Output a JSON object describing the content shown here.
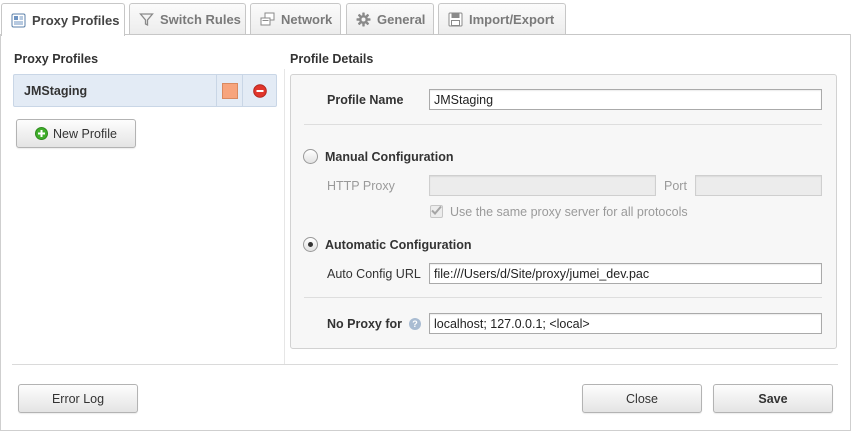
{
  "tabs": [
    {
      "label": "Proxy Profiles",
      "icon": "proxy-profiles-icon",
      "active": true
    },
    {
      "label": "Switch Rules",
      "icon": "switch-rules-icon",
      "active": false
    },
    {
      "label": "Network",
      "icon": "network-icon",
      "active": false
    },
    {
      "label": "General",
      "icon": "gear-icon",
      "active": false
    },
    {
      "label": "Import/Export",
      "icon": "disk-icon",
      "active": false
    }
  ],
  "left": {
    "title": "Proxy Profiles",
    "profiles": [
      {
        "name": "JMStaging",
        "color": "#f7a47c"
      }
    ],
    "new_profile_label": "New Profile"
  },
  "details": {
    "title": "Profile Details",
    "profile_name_label": "Profile Name",
    "profile_name_value": "JMStaging",
    "manual_label": "Manual Configuration",
    "manual_selected": false,
    "http_proxy_label": "HTTP Proxy",
    "http_proxy_value": "",
    "port_label": "Port",
    "port_value": "",
    "same_proxy_label": "Use the same proxy server for all protocols",
    "same_proxy_checked": true,
    "auto_label": "Automatic Configuration",
    "auto_selected": true,
    "auto_url_label": "Auto Config URL",
    "auto_url_value": "file:///Users/d/Site/proxy/jumei_dev.pac",
    "no_proxy_label": "No Proxy for",
    "no_proxy_value": "localhost; 127.0.0.1; <local>"
  },
  "footer": {
    "error_log_label": "Error Log",
    "close_label": "Close",
    "save_label": "Save"
  },
  "colors": {
    "selection_bg": "#e3ebf5",
    "swatch": "#f7a47c",
    "delete_red": "#e0352b",
    "new_profile_green": "#3fae2a"
  }
}
